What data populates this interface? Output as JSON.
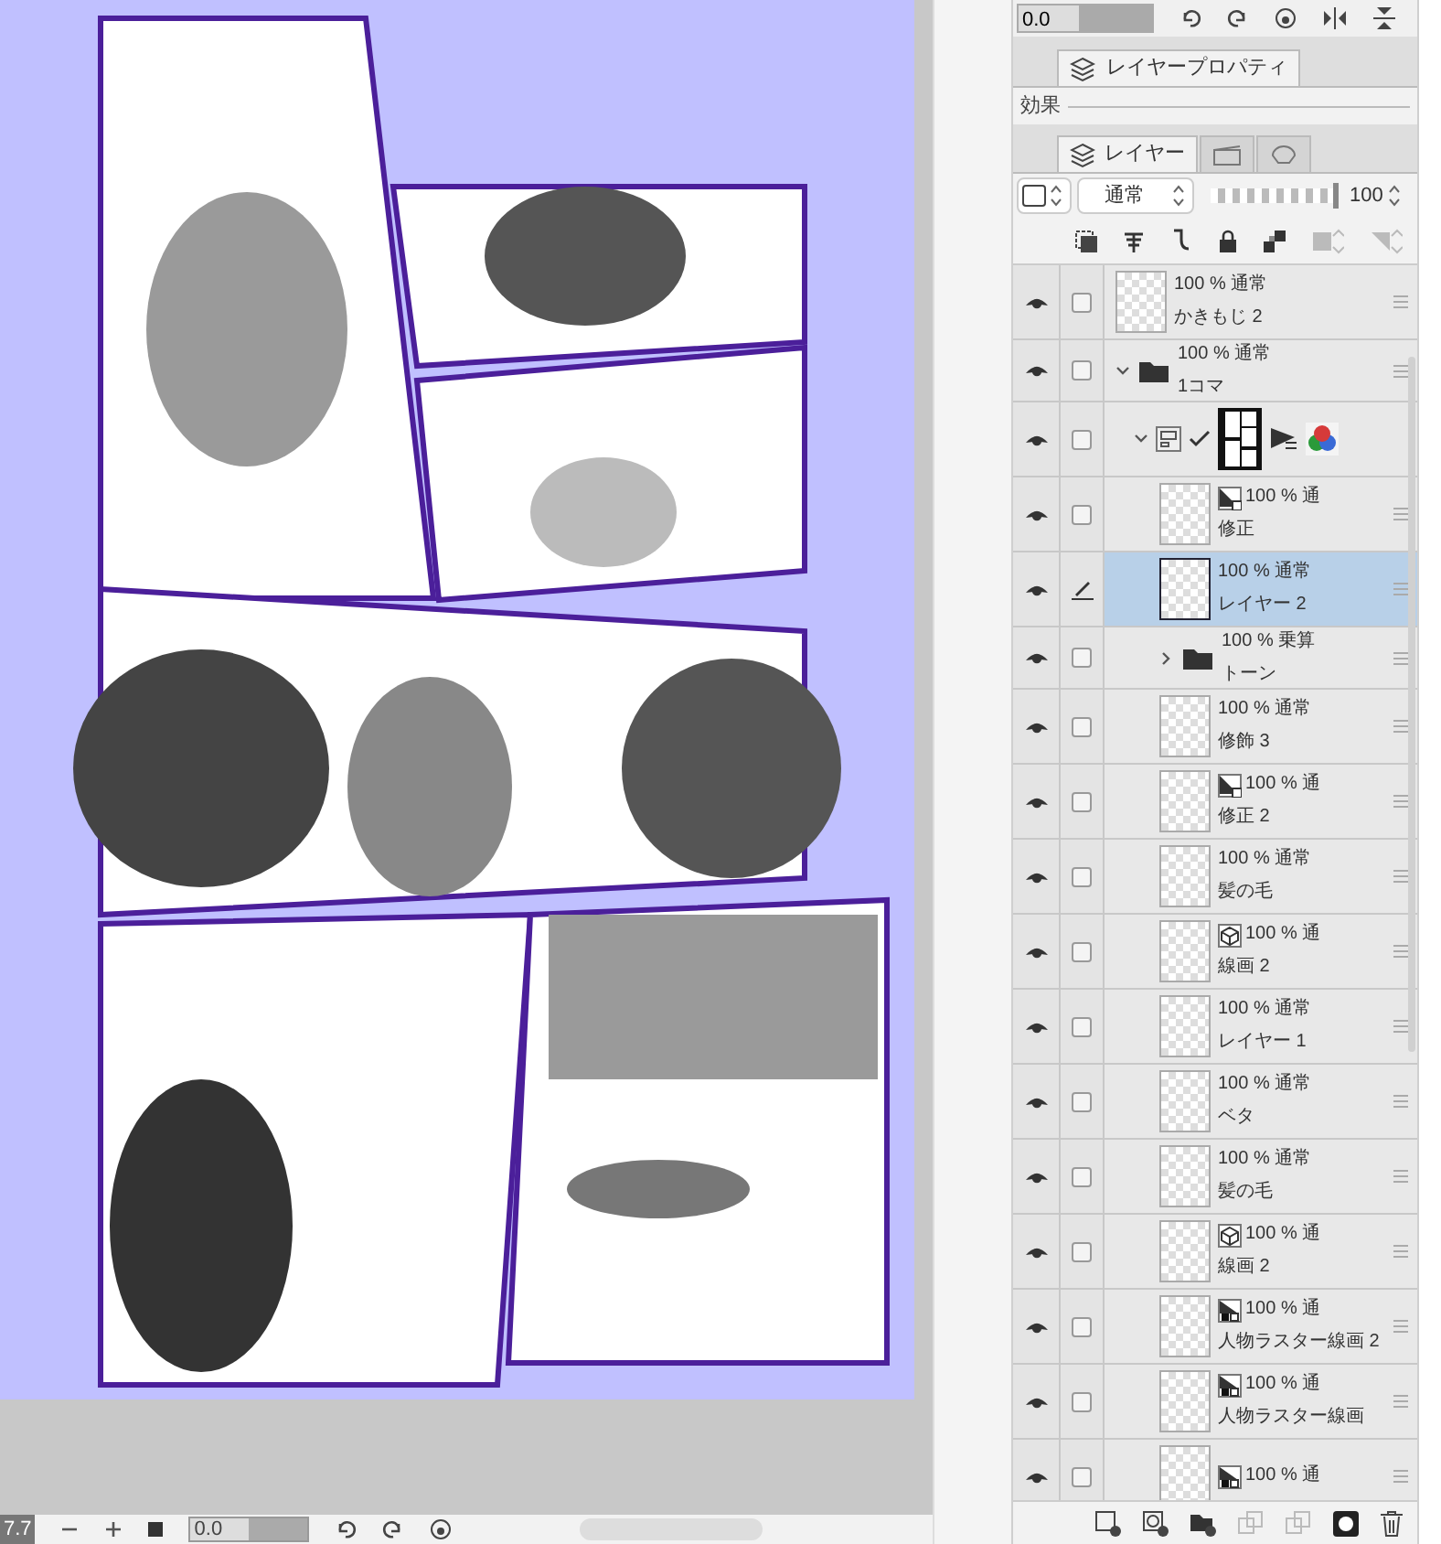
{
  "canvas_toolbar": {
    "zoom": "7.7",
    "angle": "0.0"
  },
  "top_toolbar": {
    "angle": "0.0"
  },
  "layer_property_panel": {
    "tab": "レイヤープロパティ",
    "section": "効果"
  },
  "layer_panel": {
    "tabs": [
      {
        "label": "レイヤー",
        "selected": true
      },
      {
        "selected": false
      },
      {
        "selected": false
      }
    ],
    "blend_mode": "通常",
    "opacity": {
      "level": 1,
      "value": "100"
    },
    "layers": [
      {
        "kind": "layer",
        "name": "かきもじ 2",
        "blend": "100 % 通常",
        "visible": true,
        "editing": false,
        "selected": false
      },
      {
        "kind": "folder",
        "name": "1コマ",
        "blend": "100 % 通常",
        "visible": true,
        "editing": false,
        "selected": false,
        "expanded": true,
        "children": [
          {
            "kind": "frame",
            "visible": true,
            "editing": false,
            "selected": false,
            "expanded": true,
            "children": [
              {
                "kind": "layer",
                "badge": {
                  "kind": "mask"
                },
                "name": "修正",
                "blend": "100 % 通",
                "visible": true,
                "editing": false,
                "selected": false
              },
              {
                "kind": "layer",
                "name": "レイヤー 2",
                "blend": "100 % 通常",
                "visible": true,
                "editing": true,
                "selected": true
              },
              {
                "kind": "folder",
                "name": "トーン",
                "blend": "100 % 乗算",
                "visible": true,
                "editing": false,
                "selected": false,
                "expanded": false
              },
              {
                "kind": "layer",
                "name": "修飾 3",
                "blend": "100 % 通常",
                "visible": true,
                "editing": false,
                "selected": false
              },
              {
                "kind": "layer",
                "badge": {
                  "kind": "mask"
                },
                "name": "修正 2",
                "blend": "100 % 通",
                "visible": true,
                "editing": false,
                "selected": false
              },
              {
                "kind": "layer",
                "name": "髪の毛",
                "blend": "100 % 通常",
                "visible": true,
                "editing": false,
                "selected": false
              },
              {
                "kind": "layer",
                "badge": {
                  "kind": "cube"
                },
                "name": "線画 2",
                "blend": "100 % 通",
                "visible": true,
                "editing": false,
                "selected": false
              },
              {
                "kind": "layer",
                "name": "レイヤー 1",
                "blend": "100 % 通常",
                "visible": true,
                "editing": false,
                "selected": false
              },
              {
                "kind": "layer",
                "name": "ベタ",
                "blend": "100 % 通常",
                "visible": true,
                "editing": false,
                "selected": false
              },
              {
                "kind": "layer",
                "name": "髪の毛",
                "blend": "100 % 通常",
                "visible": true,
                "editing": false,
                "selected": false
              },
              {
                "kind": "layer",
                "badge": {
                  "kind": "cube"
                },
                "name": "線画 2",
                "blend": "100 % 通",
                "visible": true,
                "editing": false,
                "selected": false
              },
              {
                "kind": "layer",
                "badge": {
                  "kind": "tone"
                },
                "name": "人物ラスター線画 2",
                "blend": "100 % 通",
                "visible": true,
                "editing": false,
                "selected": false
              },
              {
                "kind": "layer",
                "badge": {
                  "kind": "tone"
                },
                "name": "人物ラスター線画",
                "blend": "100 % 通",
                "visible": true,
                "editing": false,
                "selected": false
              },
              {
                "kind": "layer",
                "badge": {
                  "kind": "tone"
                },
                "blend": "100 % 通",
                "visible": true,
                "editing": false,
                "selected": false
              }
            ]
          }
        ]
      }
    ]
  }
}
